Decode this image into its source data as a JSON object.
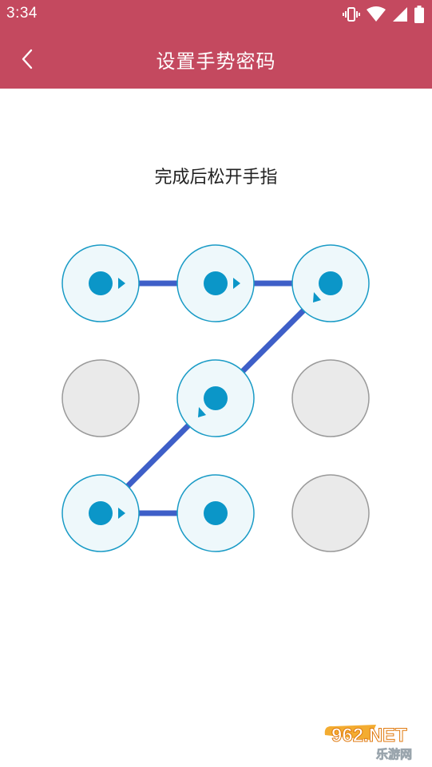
{
  "status_bar": {
    "time": "3:34",
    "icons": [
      "vibrate-icon",
      "wifi-icon",
      "signal-icon",
      "battery-icon"
    ]
  },
  "app_bar": {
    "back_icon": "chevron-left-icon",
    "title": "设置手势密码"
  },
  "instruction": "完成后松开手指",
  "pattern": {
    "rows": 3,
    "cols": 3,
    "selected_order": [
      1,
      2,
      3,
      5,
      7,
      8
    ],
    "selected_direction": {
      "1": "right",
      "2": "right",
      "3": "down-left",
      "5": "down-left",
      "7": "right"
    }
  },
  "colors": {
    "header": "#c4495f",
    "node_active_border": "#1a9bc6",
    "node_active_fill": "#eef8fb",
    "node_dot": "#0b96c8",
    "node_idle_fill": "#eaeaea",
    "node_idle_border": "#9a9a9a",
    "connector": "#3e5fc8"
  },
  "watermark": {
    "brand": "962.NET",
    "sub": "乐游网"
  }
}
